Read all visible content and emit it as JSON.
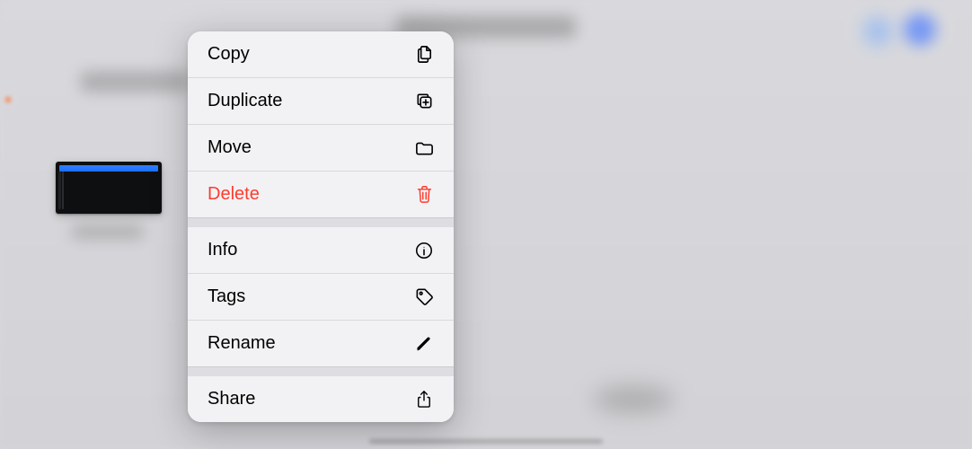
{
  "menu": {
    "copy": "Copy",
    "duplicate": "Duplicate",
    "move": "Move",
    "delete": "Delete",
    "info": "Info",
    "tags": "Tags",
    "rename": "Rename",
    "share": "Share"
  },
  "colors": {
    "destructive": "#ff3b30",
    "selection": "#2f7fff"
  }
}
